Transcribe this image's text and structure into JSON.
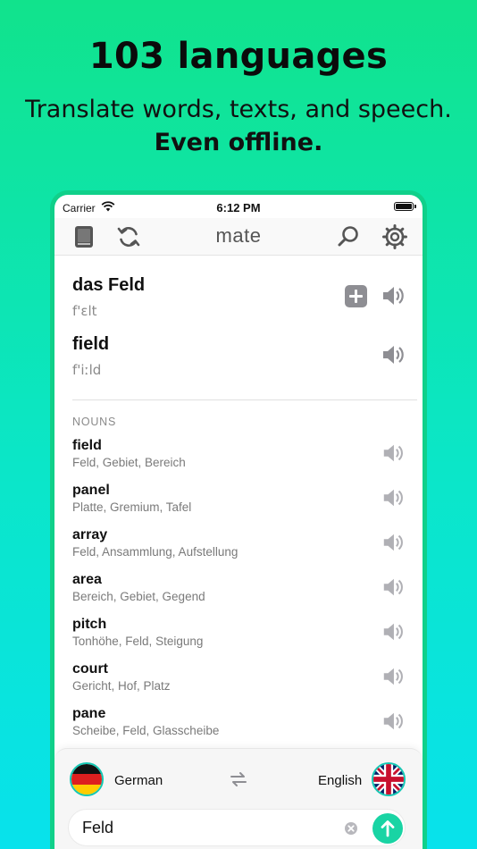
{
  "promo": {
    "headline": "103 languages",
    "subline_regular": "Translate words, texts, and speech.",
    "subline_bold": "Even offline."
  },
  "status_bar": {
    "carrier": "Carrier",
    "time": "6:12 PM"
  },
  "toolbar": {
    "title": "mate"
  },
  "entries": [
    {
      "word": "das Feld",
      "ipa": "f'ɛlt"
    },
    {
      "word": "field",
      "ipa": "f'iːld"
    }
  ],
  "nouns": {
    "label": "NOUNS",
    "items": [
      {
        "word": "field",
        "translations": "Feld, Gebiet, Bereich"
      },
      {
        "word": "panel",
        "translations": "Platte, Gremium, Tafel"
      },
      {
        "word": "array",
        "translations": "Feld, Ansammlung, Aufstellung"
      },
      {
        "word": "area",
        "translations": "Bereich, Gebiet, Gegend"
      },
      {
        "word": "pitch",
        "translations": "Tonhöhe, Feld, Steigung"
      },
      {
        "word": "court",
        "translations": "Gericht, Hof, Platz"
      },
      {
        "word": "pane",
        "translations": "Scheibe, Feld, Glasscheibe"
      }
    ]
  },
  "languages": {
    "source": "German",
    "target": "English"
  },
  "input": {
    "value": "Feld"
  },
  "colors": {
    "accent": "#19d4a4",
    "frame": "#10d08a",
    "icon_gray": "#8e8e93"
  },
  "icons": {
    "book": "book-icon",
    "sync": "sync-icon",
    "search": "search-icon",
    "settings": "gear-icon",
    "speaker": "speaker-icon",
    "add": "plus-icon",
    "swap": "swap-arrows-icon",
    "clear": "clear-icon",
    "go": "arrow-up-icon"
  }
}
